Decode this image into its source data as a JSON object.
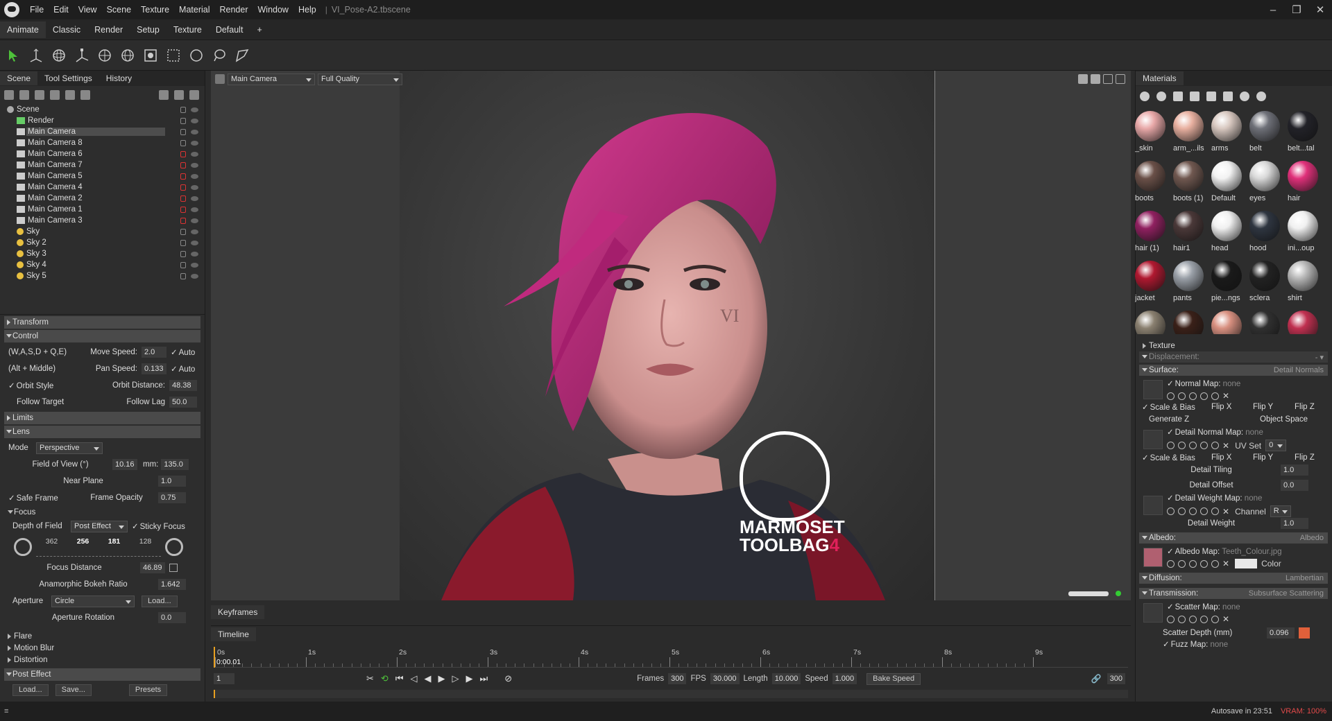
{
  "app": {
    "title": "VI_Pose-A2.tbscene",
    "menus": [
      "File",
      "Edit",
      "View",
      "Scene",
      "Texture",
      "Material",
      "Render",
      "Window",
      "Help"
    ]
  },
  "layouts": [
    "Animate",
    "Classic",
    "Render",
    "Setup",
    "Texture",
    "Default",
    "+"
  ],
  "left_tabs": [
    "Scene",
    "Tool Settings",
    "History"
  ],
  "tree": [
    {
      "label": "Scene",
      "type": "scene"
    },
    {
      "label": "Render",
      "type": "render"
    },
    {
      "label": "Main Camera",
      "type": "camera",
      "selected": true
    },
    {
      "label": "Main Camera 8",
      "type": "camera"
    },
    {
      "label": "Main Camera 6",
      "type": "camera"
    },
    {
      "label": "Main Camera 7",
      "type": "camera"
    },
    {
      "label": "Main Camera 5",
      "type": "camera"
    },
    {
      "label": "Main Camera 4",
      "type": "camera"
    },
    {
      "label": "Main Camera 2",
      "type": "camera"
    },
    {
      "label": "Main Camera 1",
      "type": "camera"
    },
    {
      "label": "Main Camera 3",
      "type": "camera"
    },
    {
      "label": "Sky",
      "type": "sky"
    },
    {
      "label": "Sky 2",
      "type": "sky"
    },
    {
      "label": "Sky 3",
      "type": "sky"
    },
    {
      "label": "Sky 4",
      "type": "sky"
    },
    {
      "label": "Sky 5",
      "type": "sky"
    }
  ],
  "sections": {
    "transform": "Transform",
    "control": "Control",
    "limits": "Limits",
    "lens": "Lens",
    "focus": "Focus",
    "flare": "Flare",
    "motion_blur": "Motion Blur",
    "distortion": "Distortion",
    "post_effect": "Post Effect"
  },
  "control": {
    "keys1": "(W,A,S,D + Q,E)",
    "move_speed_label": "Move Speed:",
    "move_speed": "2.0",
    "auto1": "Auto",
    "keys2": "(Alt + Middle)",
    "pan_speed_label": "Pan Speed:",
    "pan_speed": "0.133",
    "auto2": "Auto",
    "orbit_style": "Orbit Style",
    "orbit_dist_label": "Orbit Distance:",
    "orbit_dist": "48.38",
    "follow_target": "Follow Target",
    "follow_lag_label": "Follow Lag",
    "follow_lag": "50.0"
  },
  "lens": {
    "mode_label": "Mode",
    "mode": "Perspective",
    "fov_label": "Field of View (°)",
    "fov": "10.16",
    "mm_label": "mm:",
    "mm": "135.0",
    "near_label": "Near Plane",
    "near": "1.0",
    "safe_frame": "Safe Frame",
    "frame_opacity_label": "Frame Opacity",
    "frame_opacity": "0.75"
  },
  "focus": {
    "dof_label": "Depth of Field",
    "dof": "Post Effect",
    "sticky": "Sticky Focus",
    "scale": [
      "362",
      "256",
      "181",
      "128"
    ],
    "focus_dist_label": "Focus Distance",
    "focus_dist": "46.89",
    "bokeh_label": "Anamorphic Bokeh Ratio",
    "bokeh": "1.642",
    "aperture_label": "Aperture",
    "aperture": "Circle",
    "load": "Load...",
    "ap_rot_label": "Aperture Rotation",
    "ap_rot": "0.0"
  },
  "post_buttons": [
    "Load...",
    "Save...",
    "Presets"
  ],
  "viewport": {
    "camera": "Main Camera",
    "quality": "Full Quality",
    "watermark_line1": "MARMOSET",
    "watermark_line2": "TOOLBAG",
    "watermark_num": "4"
  },
  "keyframes_tab": "Keyframes",
  "timeline": {
    "tab": "Timeline",
    "current": "0:00.01",
    "frame": "1",
    "ticks": [
      "0s",
      "1s",
      "2s",
      "3s",
      "4s",
      "5s",
      "6s",
      "7s",
      "8s",
      "9s"
    ],
    "frames_label": "Frames",
    "frames": "300",
    "fps_label": "FPS",
    "fps": "30.000",
    "length_label": "Length",
    "length": "10.000",
    "speed_label": "Speed",
    "speed": "1.000",
    "bake": "Bake Speed",
    "end": "300"
  },
  "materials_tab": "Materials",
  "materials": [
    {
      "label": "_skin",
      "color": "#e8a8a8"
    },
    {
      "label": "arm_...ils",
      "color": "#e8b0a0"
    },
    {
      "label": "arms",
      "color": "#d8c8c0"
    },
    {
      "label": "belt",
      "color": "#6e7078"
    },
    {
      "label": "belt...tal",
      "color": "#222228"
    },
    {
      "label": "boots",
      "color": "#6a5048"
    },
    {
      "label": "boots (1)",
      "color": "#705850"
    },
    {
      "label": "Default",
      "color": "#f2f2f2"
    },
    {
      "label": "eyes",
      "color": "#d8d8d8"
    },
    {
      "label": "hair",
      "color": "#e0307a"
    },
    {
      "label": "hair (1)",
      "color": "#902060"
    },
    {
      "label": "hair1",
      "color": "#4a3838"
    },
    {
      "label": "head",
      "color": "#f0f0f0"
    },
    {
      "label": "hood",
      "color": "#2e3540"
    },
    {
      "label": "ini...oup",
      "color": "#f0f0f0"
    },
    {
      "label": "jacket",
      "color": "#b01830"
    },
    {
      "label": "pants",
      "color": "#9aa0a8"
    },
    {
      "label": "pie...ngs",
      "color": "#1a1a1a"
    },
    {
      "label": "sclera",
      "color": "#222222"
    },
    {
      "label": "shirt",
      "color": "#b8b8b8"
    },
    {
      "label": "",
      "color": "#8a8070"
    },
    {
      "label": "",
      "color": "#3a2018"
    },
    {
      "label": "",
      "color": "#d89080"
    },
    {
      "label": "",
      "color": "#303030"
    },
    {
      "label": "",
      "color": "#c03050"
    }
  ],
  "texture_section": "Texture",
  "displacement": "Displacement:",
  "surface": {
    "label": "Surface:",
    "value": "Detail Normals",
    "normal_map": "Normal Map:",
    "none": "none",
    "scale_bias": "Scale & Bias",
    "flip_x": "Flip X",
    "flip_y": "Flip Y",
    "flip_z": "Flip Z",
    "gen_z": "Generate Z",
    "obj_space": "Object Space",
    "detail_normal": "Detail Normal Map:",
    "uv_set": "UV Set",
    "uv_val": "0",
    "detail_tiling": "Detail Tiling",
    "tiling_val": "1.0",
    "detail_offset": "Detail Offset",
    "offset_val": "0.0",
    "detail_weight_map": "Detail Weight Map:",
    "channel": "Channel",
    "channel_val": "R",
    "detail_weight": "Detail Weight",
    "weight_val": "1.0"
  },
  "albedo": {
    "label": "Albedo:",
    "value": "Albedo",
    "map": "Albedo Map:",
    "file": "Teeth_Colour.jpg",
    "color": "Color"
  },
  "diffusion": {
    "label": "Diffusion:",
    "value": "Lambertian"
  },
  "transmission": {
    "label": "Transmission:",
    "value": "Subsurface Scattering",
    "scatter_map": "Scatter Map:",
    "scatter_depth": "Scatter Depth (mm)",
    "depth_val": "0.096",
    "fuzz_map": "Fuzz Map:"
  },
  "status": {
    "autosave": "Autosave in 23:51",
    "vram": "VRAM: 100%"
  }
}
